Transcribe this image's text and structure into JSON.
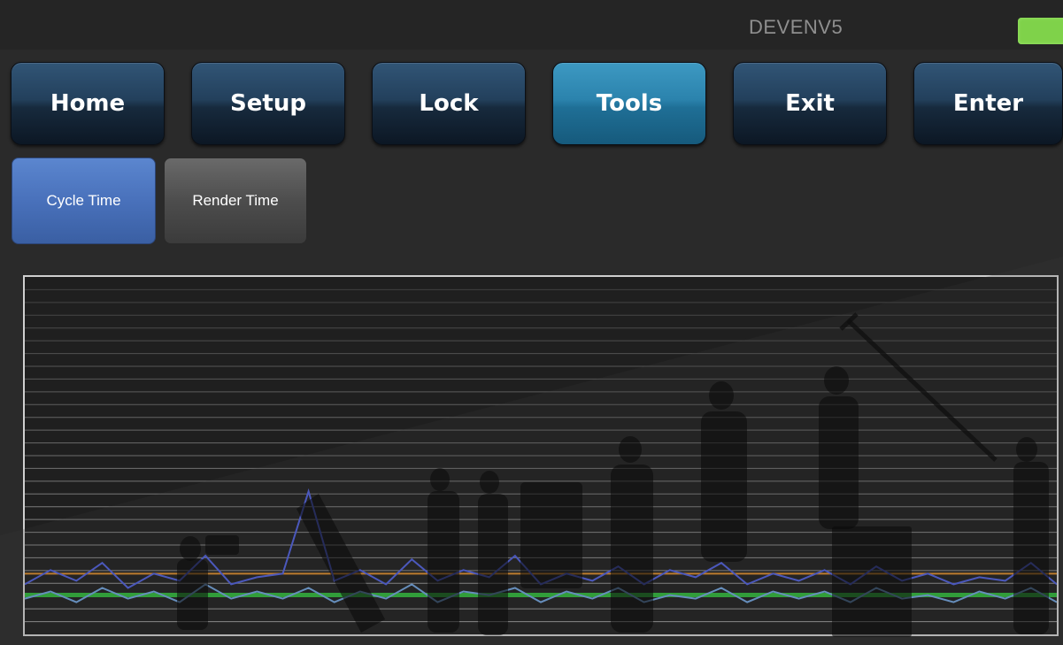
{
  "header": {
    "title": "DEVENV5",
    "status_color": "#7fd24a"
  },
  "nav": {
    "buttons": [
      {
        "label": "Home"
      },
      {
        "label": "Setup"
      },
      {
        "label": "Lock"
      },
      {
        "label": "Tools"
      },
      {
        "label": "Exit"
      },
      {
        "label": "Enter"
      }
    ],
    "active": "Tools"
  },
  "subtabs": {
    "cycle_time": "Cycle Time",
    "render_time": "Render Time",
    "active": "Cycle Time"
  },
  "chart_data": {
    "type": "line",
    "title": "",
    "xlabel": "",
    "ylabel": "",
    "grid": true,
    "ylim": [
      0,
      100
    ],
    "series": [
      {
        "color": "#4f5fd8",
        "values": [
          14,
          18,
          15,
          20,
          13,
          17,
          15,
          22,
          14,
          16,
          17,
          40,
          15,
          18,
          14,
          21,
          15,
          18,
          16,
          22,
          14,
          17,
          15,
          19,
          14,
          18,
          16,
          20,
          14,
          17,
          15,
          18,
          14,
          19,
          15,
          17,
          14,
          16,
          15,
          20,
          14
        ]
      },
      {
        "color": "#6fa0d8",
        "values": [
          10,
          12,
          9,
          13,
          10,
          12,
          9,
          14,
          10,
          12,
          10,
          13,
          9,
          12,
          10,
          14,
          9,
          12,
          11,
          13,
          9,
          12,
          10,
          13,
          9,
          11,
          10,
          13,
          9,
          12,
          10,
          12,
          9,
          13,
          10,
          11,
          9,
          12,
          10,
          13,
          9
        ]
      }
    ],
    "reference_lines": [
      {
        "color": "#d98a2b",
        "value": 17
      },
      {
        "color": "#2fb33a",
        "value": 11
      }
    ]
  }
}
